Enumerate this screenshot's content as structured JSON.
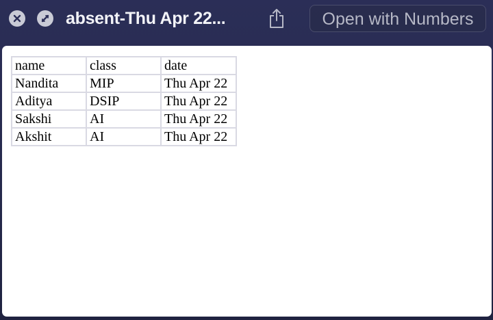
{
  "window": {
    "title": "absent-Thu Apr 22...",
    "open_button_label": "Open with Numbers"
  },
  "icons": {
    "close": "close-x-icon",
    "fullscreen": "fullscreen-slash-icon",
    "share": "share-icon"
  },
  "colors": {
    "titlebar_bg": "#2b2e57",
    "preview_bg": "#ffffff",
    "grid_line": "#d9d9e3"
  },
  "table": {
    "headers": [
      "name",
      "class",
      "date"
    ],
    "rows": [
      [
        "Nandita",
        "MIP",
        "Thu Apr 22"
      ],
      [
        "Aditya",
        "DSIP",
        "Thu Apr 22"
      ],
      [
        "Sakshi",
        "AI",
        "Thu Apr 22"
      ],
      [
        "Akshit",
        "AI",
        "Thu Apr 22"
      ]
    ]
  }
}
